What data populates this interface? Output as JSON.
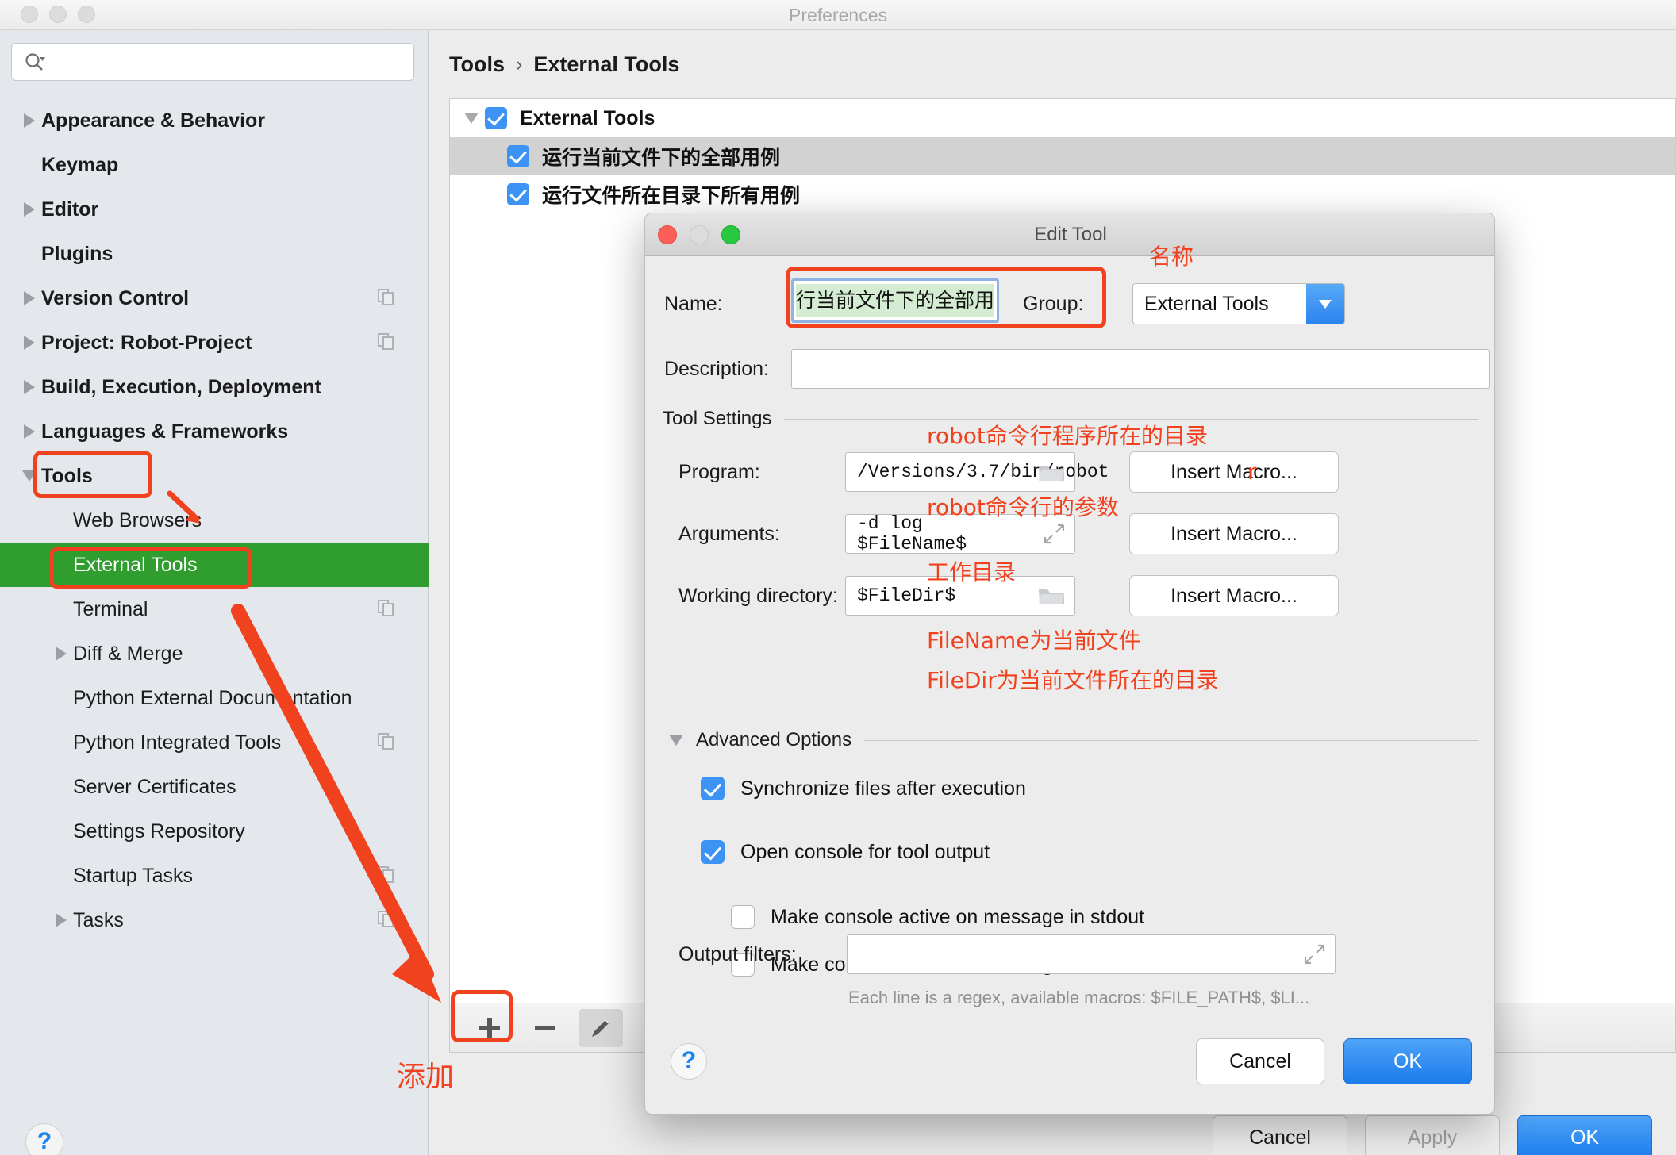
{
  "window": {
    "title": "Preferences",
    "traffic_lights": [
      "close",
      "minimize",
      "zoom"
    ]
  },
  "sidebar": {
    "search": {
      "value": "",
      "placeholder": ""
    },
    "items": [
      {
        "label": "Appearance & Behavior",
        "level": 0,
        "arrow": "right",
        "copy": false,
        "selected": false
      },
      {
        "label": "Keymap",
        "level": 0,
        "arrow": "none",
        "copy": false,
        "selected": false
      },
      {
        "label": "Editor",
        "level": 0,
        "arrow": "right",
        "copy": false,
        "selected": false
      },
      {
        "label": "Plugins",
        "level": 0,
        "arrow": "none",
        "copy": false,
        "selected": false
      },
      {
        "label": "Version Control",
        "level": 0,
        "arrow": "right",
        "copy": true,
        "selected": false
      },
      {
        "label": "Project: Robot-Project",
        "level": 0,
        "arrow": "right",
        "copy": true,
        "selected": false
      },
      {
        "label": "Build, Execution, Deployment",
        "level": 0,
        "arrow": "right",
        "copy": false,
        "selected": false
      },
      {
        "label": "Languages & Frameworks",
        "level": 0,
        "arrow": "right",
        "copy": false,
        "selected": false
      },
      {
        "label": "Tools",
        "level": 0,
        "arrow": "down",
        "copy": false,
        "selected": false
      },
      {
        "label": "Web Browsers",
        "level": 1,
        "arrow": "none",
        "copy": false,
        "selected": false
      },
      {
        "label": "External Tools",
        "level": 1,
        "arrow": "none",
        "copy": false,
        "selected": true
      },
      {
        "label": "Terminal",
        "level": 1,
        "arrow": "none",
        "copy": true,
        "selected": false
      },
      {
        "label": "Diff & Merge",
        "level": 1,
        "arrow": "right",
        "copy": false,
        "selected": false
      },
      {
        "label": "Python External Documentation",
        "level": 1,
        "arrow": "none",
        "copy": false,
        "selected": false
      },
      {
        "label": "Python Integrated Tools",
        "level": 1,
        "arrow": "none",
        "copy": true,
        "selected": false
      },
      {
        "label": "Server Certificates",
        "level": 1,
        "arrow": "none",
        "copy": false,
        "selected": false
      },
      {
        "label": "Settings Repository",
        "level": 1,
        "arrow": "none",
        "copy": false,
        "selected": false
      },
      {
        "label": "Startup Tasks",
        "level": 1,
        "arrow": "none",
        "copy": true,
        "selected": false
      },
      {
        "label": "Tasks",
        "level": 1,
        "arrow": "right",
        "copy": true,
        "selected": false
      }
    ],
    "help_label": "?"
  },
  "content": {
    "breadcrumb": {
      "parent": "Tools",
      "separator": "›",
      "current": "External Tools"
    },
    "tree": [
      {
        "label": "External Tools",
        "checked": true,
        "level": 0,
        "expanded": true,
        "highlighted": false
      },
      {
        "label": "运行当前文件下的全部用例",
        "checked": true,
        "level": 1,
        "expanded": false,
        "highlighted": true
      },
      {
        "label": "运行文件所在目录下所有用例",
        "checked": true,
        "level": 1,
        "expanded": false,
        "highlighted": false
      }
    ],
    "toolbar": {
      "add": "+",
      "remove": "−",
      "edit": "pencil",
      "move_up": "triangle-up"
    },
    "buttons": {
      "cancel": "Cancel",
      "apply": "Apply",
      "ok": "OK"
    }
  },
  "dialog": {
    "title": "Edit Tool",
    "name_label": "Name:",
    "name_value": "行当前文件下的全部用例",
    "group_label": "Group:",
    "group_value": "External Tools",
    "description_label": "Description:",
    "description_value": "",
    "tool_settings_label": "Tool Settings",
    "program_label": "Program:",
    "program_value": "/Versions/3.7/bin/robot",
    "arguments_label": "Arguments:",
    "arguments_value": "-d log $FileName$",
    "working_dir_label": "Working directory:",
    "working_dir_value": "$FileDir$",
    "insert_macro_label": "Insert Macro...",
    "advanced_options_label": "Advanced Options",
    "checkboxes": [
      {
        "label": "Synchronize files after execution",
        "checked": true,
        "indent": 0
      },
      {
        "label": "Open console for tool output",
        "checked": true,
        "indent": 0
      },
      {
        "label": "Make console active on message in stdout",
        "checked": false,
        "indent": 1
      },
      {
        "label": "Make console active on message in stderr",
        "checked": false,
        "indent": 1
      }
    ],
    "output_filters_label": "Output filters:",
    "output_filters_value": "",
    "output_filters_hint": "Each line is a regex, available macros: $FILE_PATH$, $LI...",
    "help_label": "?",
    "cancel_label": "Cancel",
    "ok_label": "OK"
  },
  "annotations": {
    "color": "#f0421f",
    "name_note": "名称",
    "program_note": "robot命令行程序所在的目录",
    "program_note_tail": "r",
    "arguments_note": "robot命令行的参数",
    "workdir_note": "工作目录",
    "macro_note_line1": "FileName为当前文件",
    "macro_note_line2": "FileDir为当前文件所在的目录",
    "add_note": "添加"
  }
}
